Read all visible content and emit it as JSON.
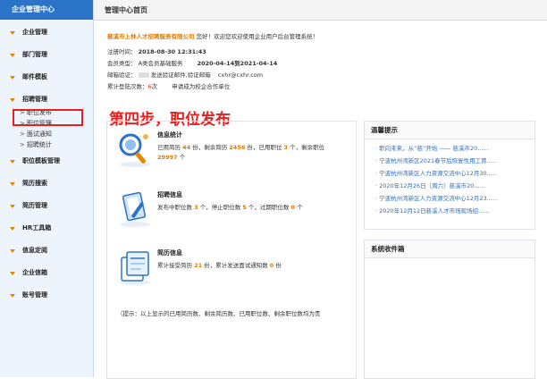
{
  "sidebar": {
    "title": "企业管理中心",
    "groups": [
      {
        "label": "企业管理"
      },
      {
        "label": "部门管理"
      },
      {
        "label": "邮件模板"
      },
      {
        "label": "招聘管理",
        "items": [
          "职位发布",
          "职位管理",
          "面试通知",
          "招聘统计"
        ]
      },
      {
        "label": "职位模板管理"
      },
      {
        "label": "简历搜索"
      },
      {
        "label": "简历管理"
      },
      {
        "label": "HR工具箱"
      },
      {
        "label": "信息定阅"
      },
      {
        "label": "企业信箱"
      },
      {
        "label": "账号管理"
      }
    ]
  },
  "header": {
    "title": "管理中心首页"
  },
  "info": {
    "company": "慈溪市上林人才招聘服务有限公司",
    "welcome": "您好！欢迎您欢迎使用企业用户后台管理系统！",
    "reg_label": "注册时间：",
    "reg_time": "2018-08-30 12:31:43",
    "member_label": "会员类型：",
    "member_type": "A类会员基础服务",
    "member_period": "2020-04-14到2021-04-14",
    "mail_label": "邮箱验证：",
    "mail_text": "发送验证邮件,验证邮箱",
    "mail_addr": "cxhr@cxhr.com",
    "login_label": "累计登陆次数：",
    "login_count": "6",
    "login_unit": "次",
    "apply_text": "申请成为校企合作单位"
  },
  "step": "第四步，职位发布",
  "stats": {
    "info": {
      "title": "信息统计",
      "p1": "已用简历",
      "v1": "44",
      "u1": "份，剩余简历",
      "v2": "2456",
      "u2": "份，已用职位",
      "v3": "3",
      "u3": "个，剩余职位",
      "v4": "29997",
      "u4": "个"
    },
    "jobs": {
      "title": "招聘信息",
      "p1": "发布中职位数",
      "v1": "3",
      "u1": "个，停止职位数",
      "v2": "5",
      "u2": "个，过期职位数",
      "v3": "0",
      "u3": "个"
    },
    "resume": {
      "title": "简历信息",
      "p1": "累计接受简历",
      "v1": "21",
      "u1": "份，累计发送面试通知数",
      "v2": "0",
      "u2": "份"
    }
  },
  "tip": "（提示：以上显示的已用简历数、剩余简历数、已用职位数、剩余职位数均为贵",
  "notices": {
    "title": "温馨提示",
    "items": [
      "职向未来，从“慈”开始 —— 慈溪市20......",
      "宁波杭州湾新区2021春节后恢复性用工育......",
      "宁波杭州湾新区人力资源交流中心12月30......",
      "2020年12月26日（周六）慈溪市20......",
      "宁波杭州湾新区人力资源交流中心12月23......",
      "2020年12月12日慈溪人才市场现场招......"
    ]
  },
  "inbox": {
    "title": "系统收件箱"
  }
}
